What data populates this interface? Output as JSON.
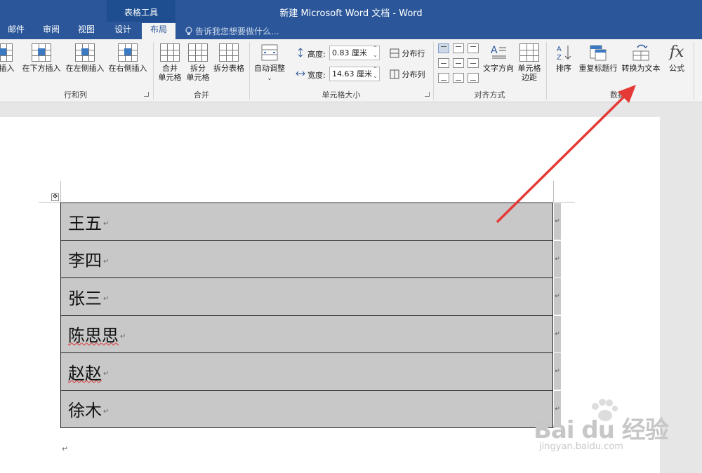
{
  "app": {
    "title": "新建 Microsoft Word 文档 - Word",
    "context_group": "表格工具",
    "accent_color": "#2b579a"
  },
  "tabs": [
    {
      "label": "邮件"
    },
    {
      "label": "审阅"
    },
    {
      "label": "视图"
    },
    {
      "label": "设计"
    },
    {
      "label": "布局",
      "active": true
    }
  ],
  "tellme": {
    "placeholder": "告诉我您想要做什么...",
    "icon": "lightbulb-icon"
  },
  "ribbon": {
    "rows_cols": {
      "label": "行和列",
      "buttons": [
        "方插入",
        "在下方插入",
        "在左侧插入",
        "在右侧插入"
      ]
    },
    "merge": {
      "label": "合并",
      "buttons": [
        {
          "line1": "合并",
          "line2": "单元格"
        },
        {
          "line1": "拆分",
          "line2": "单元格"
        },
        {
          "line1": "拆分表格",
          "line2": ""
        }
      ]
    },
    "autofit": {
      "label": "自动调整"
    },
    "cell_size": {
      "label": "单元格大小",
      "height_label": "高度:",
      "height_value": "0.83 厘米",
      "width_label": "宽度:",
      "width_value": "14.63 厘米",
      "distribute_rows": "分布行",
      "distribute_cols": "分布列"
    },
    "alignment": {
      "label": "对齐方式",
      "text_direction": "文字方向",
      "cell_margins": {
        "line1": "单元格",
        "line2": "边距"
      }
    },
    "data": {
      "label": "数据",
      "sort": "排序",
      "repeat_header": "重复标题行",
      "convert_to_text": "转换为文本",
      "formula": "公式"
    }
  },
  "document": {
    "table_rows": [
      {
        "text": "王五",
        "spell_error": false
      },
      {
        "text": "李四",
        "spell_error": false
      },
      {
        "text": "张三",
        "spell_error": false
      },
      {
        "text": "陈思思",
        "spell_error": true
      },
      {
        "text": "赵赵",
        "spell_error": true
      },
      {
        "text": "徐木",
        "spell_error": false
      }
    ],
    "cell_mark": "↵",
    "paragraph_mark": "↵"
  },
  "annotation": {
    "arrow_color": "#e53935"
  },
  "watermark": {
    "brand": "Bai du 经验",
    "url": "jingyan.baidu.com"
  }
}
